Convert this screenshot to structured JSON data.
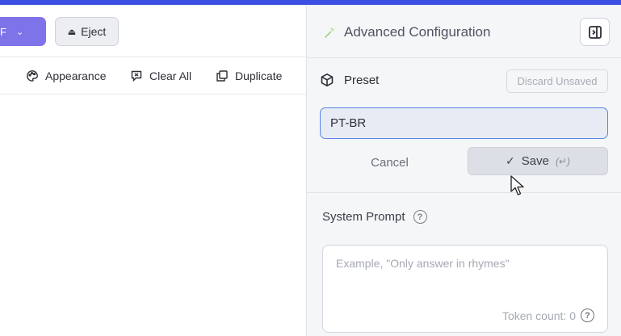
{
  "toolbar": {
    "model_btn_text": "F",
    "eject_label": "Eject",
    "actions": {
      "appearance": "Appearance",
      "clear_all": "Clear All",
      "duplicate": "Duplicate"
    }
  },
  "panel": {
    "title": "Advanced Configuration",
    "preset": {
      "label": "Preset",
      "discard_label": "Discard Unsaved",
      "input_value": "PT-BR",
      "cancel_label": "Cancel",
      "save_label": "Save",
      "save_hint": "(↵)"
    },
    "system_prompt": {
      "label": "System Prompt",
      "help_glyph": "?",
      "placeholder": "Example, \"Only answer in rhymes\"",
      "token_count": "Token count: 0"
    }
  },
  "colors": {
    "accent_topbar": "#3b4fe0",
    "model_btn": "#7e73e9",
    "input_focus": "#5b86e5"
  }
}
